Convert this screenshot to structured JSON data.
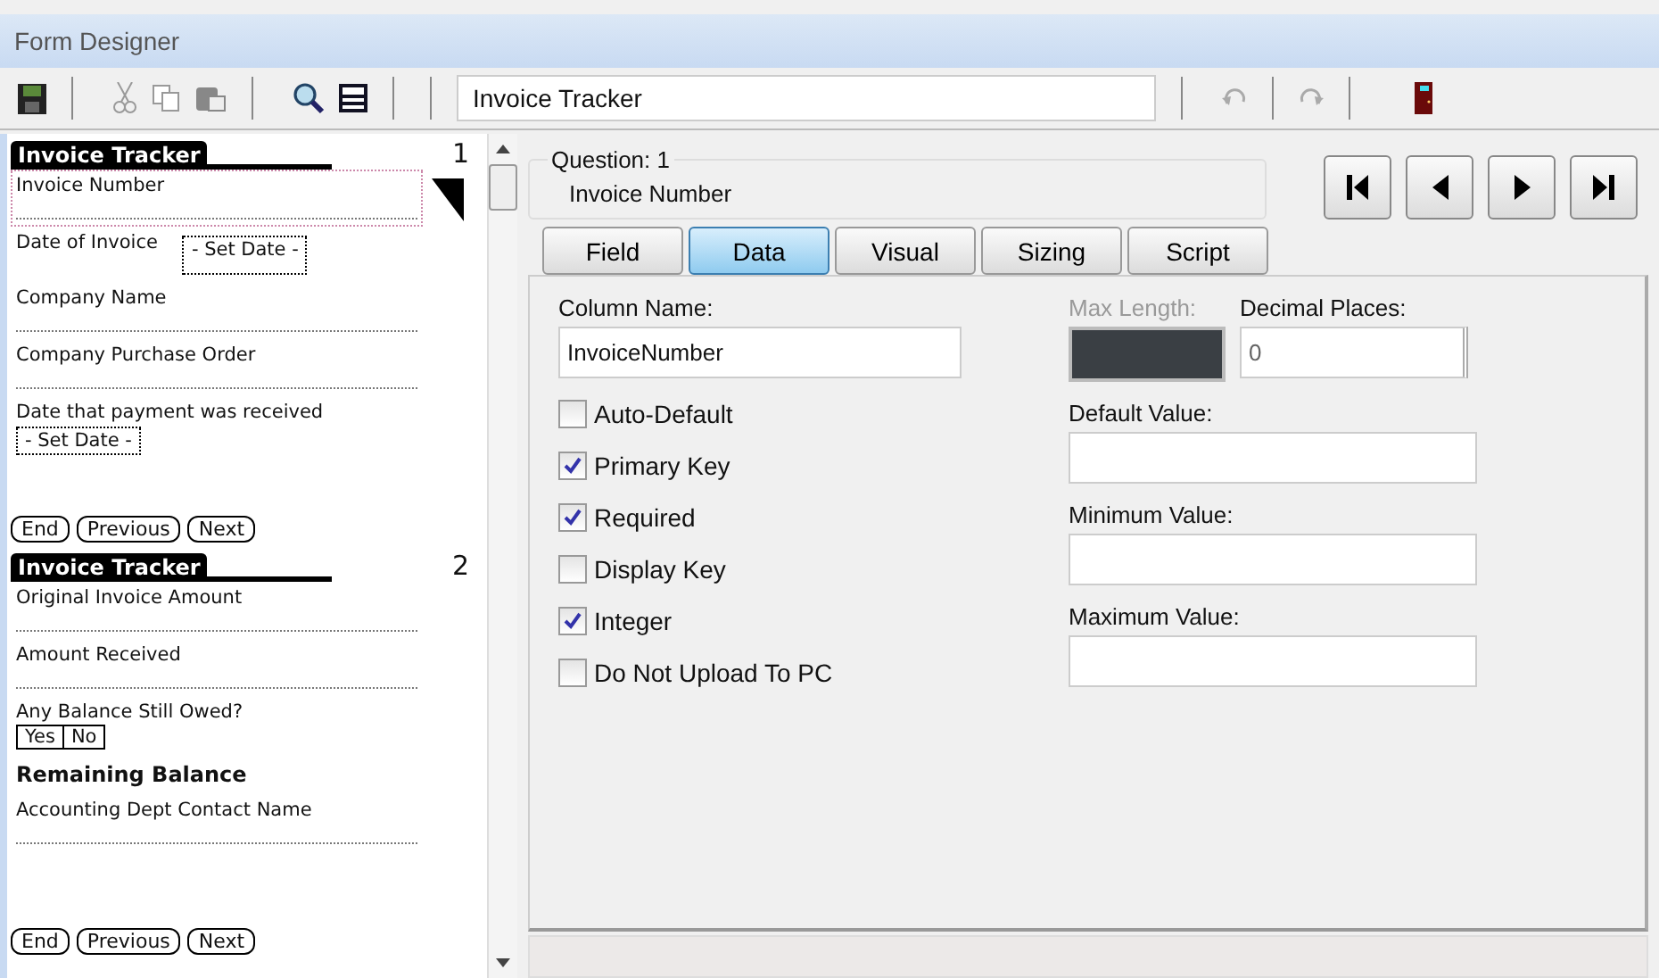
{
  "window": {
    "title": "Form Designer"
  },
  "toolbar": {
    "form_name": "Invoice Tracker"
  },
  "pages": [
    {
      "title": "Invoice Tracker",
      "number": "1",
      "fields": [
        {
          "kind": "text",
          "label": "Invoice Number",
          "selected": true
        },
        {
          "kind": "date_inline",
          "label": "Date of Invoice",
          "button": "- Set Date -",
          "selected": false
        },
        {
          "kind": "text",
          "label": "Company Name",
          "selected": false
        },
        {
          "kind": "text",
          "label": "Company Purchase Order",
          "selected": false
        },
        {
          "kind": "date_below",
          "label": "Date that payment was received",
          "button": "- Set Date -",
          "selected": false
        }
      ],
      "nav": [
        "End",
        "Previous",
        "Next"
      ]
    },
    {
      "title": "Invoice Tracker",
      "number": "2",
      "fields": [
        {
          "kind": "text",
          "label": "Original Invoice Amount",
          "selected": false
        },
        {
          "kind": "text",
          "label": "Amount Received",
          "selected": false
        },
        {
          "kind": "choice",
          "label": "Any Balance Still Owed?",
          "options": [
            "Yes",
            "No"
          ],
          "selected": false
        },
        {
          "kind": "heading",
          "label": "Remaining Balance",
          "selected": false
        },
        {
          "kind": "text",
          "label": "Accounting Dept Contact Name",
          "selected": false
        }
      ],
      "nav": [
        "End",
        "Previous",
        "Next"
      ]
    }
  ],
  "question": {
    "legend": "Question: 1",
    "name": "Invoice Number"
  },
  "tabs": [
    {
      "label": "Field",
      "selected": false
    },
    {
      "label": "Data",
      "selected": true
    },
    {
      "label": "Visual",
      "selected": false
    },
    {
      "label": "Sizing",
      "selected": false
    },
    {
      "label": "Script",
      "selected": false
    }
  ],
  "data": {
    "column_label": "Column Name:",
    "column_value": "InvoiceNumber",
    "checkboxes": [
      {
        "label": "Auto-Default",
        "checked": false
      },
      {
        "label": "Primary Key",
        "checked": true
      },
      {
        "label": "Required",
        "checked": true
      },
      {
        "label": "Display Key",
        "checked": false
      },
      {
        "label": "Integer",
        "checked": true
      },
      {
        "label": "Do Not Upload To PC",
        "checked": false
      }
    ],
    "max_length": {
      "label": "Max Length:",
      "disabled": true
    },
    "decimal": {
      "label": "Decimal Places:",
      "value": "0"
    },
    "fields": [
      {
        "label": "Default Value:"
      },
      {
        "label": "Minimum Value:"
      },
      {
        "label": "Maximum Value:"
      }
    ]
  }
}
